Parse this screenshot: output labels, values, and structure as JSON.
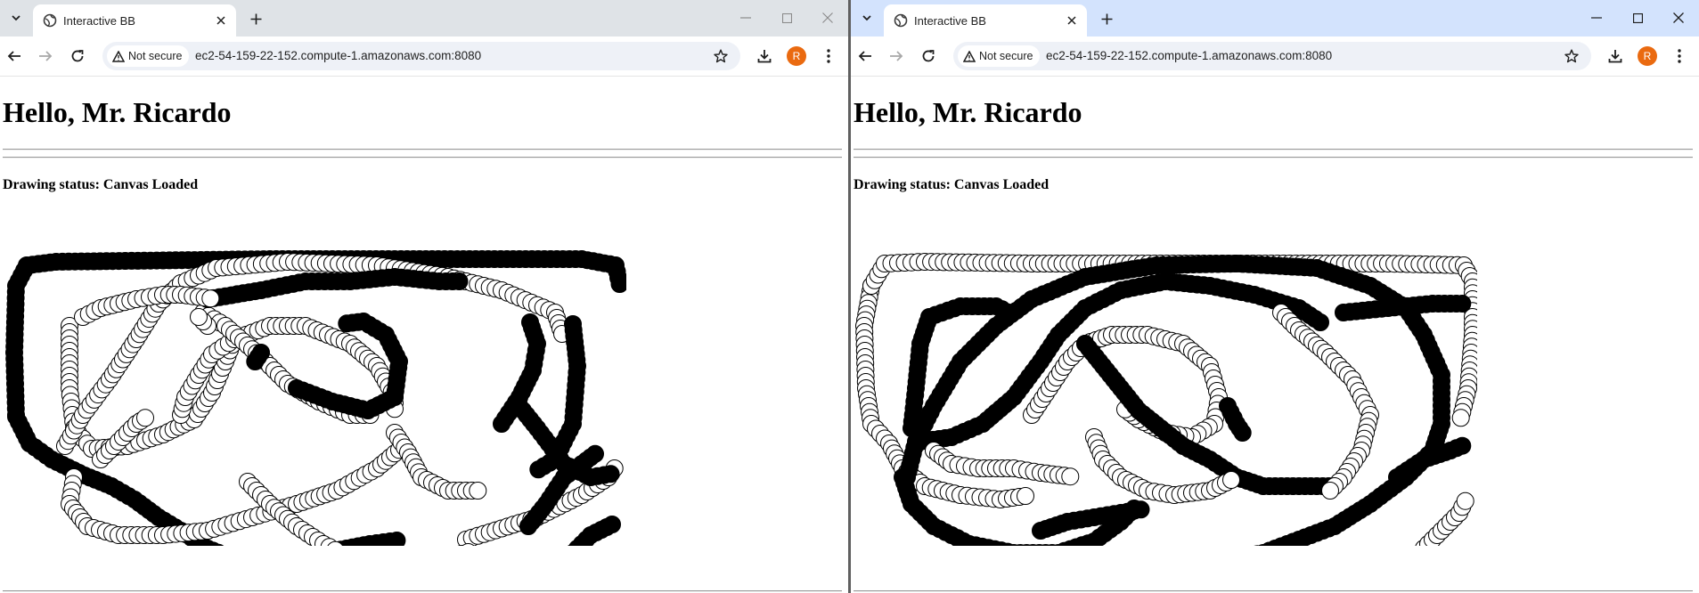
{
  "windows": [
    {
      "tab": {
        "title": "Interactive BB"
      },
      "address": {
        "security_label": "Not secure",
        "url": "ec2-54-159-22-152.compute-1.amazonaws.com:8080"
      },
      "profile_initial": "R",
      "page": {
        "greeting": "Hello, Mr. Ricardo",
        "status_label": "Drawing status:",
        "status_value": "Canvas Loaded"
      }
    },
    {
      "tab": {
        "title": "Interactive BB"
      },
      "address": {
        "security_label": "Not secure",
        "url": "ec2-54-159-22-152.compute-1.amazonaws.com:8080"
      },
      "profile_initial": "R",
      "page": {
        "greeting": "Hello, Mr. Ricardo",
        "status_label": "Drawing status:",
        "status_value": "Canvas Loaded"
      }
    }
  ],
  "colors": {
    "accent_avatar": "#ea6a10",
    "tabstrip_left": "#dfe3e7",
    "tabstrip_right": "#d3e3fd"
  },
  "icons": [
    "tab-search-icon",
    "globe-icon",
    "close-icon",
    "plus-icon",
    "minimize-icon",
    "maximize-icon",
    "back-arrow-icon",
    "forward-arrow-icon",
    "reload-icon",
    "warning-icon",
    "star-icon",
    "download-icon",
    "kebab-menu-icon"
  ]
}
